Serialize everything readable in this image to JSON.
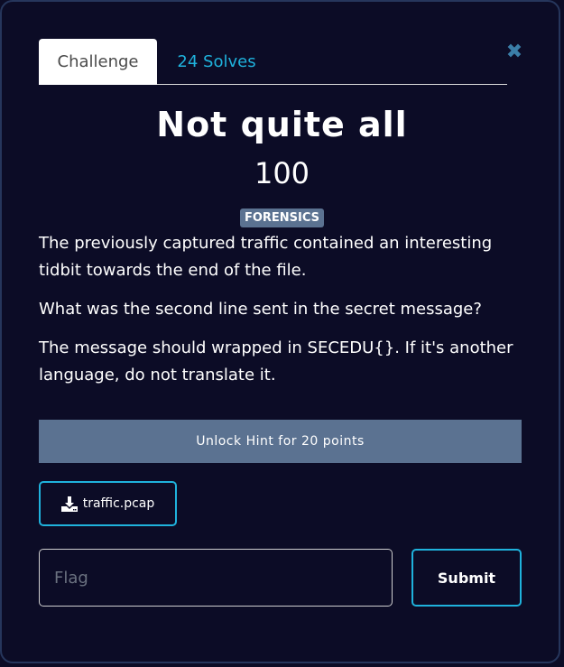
{
  "tabs": {
    "challenge_label": "Challenge",
    "solves_label": "24 Solves"
  },
  "close_icon": "close-icon",
  "challenge": {
    "title": "Not quite all",
    "points": "100",
    "category": "FORENSICS",
    "description": [
      "The previously captured traffic contained an interesting tidbit towards the end of the file.",
      "What was the second line sent in the secret message?",
      "The message should wrapped in SECEDU{}. If it's another language, do not translate it."
    ]
  },
  "hint": {
    "label": "Unlock Hint for 20 points"
  },
  "file": {
    "icon": "download-icon",
    "name": "traffic.pcap"
  },
  "flag": {
    "placeholder": "Flag",
    "value": ""
  },
  "submit": {
    "label": "Submit"
  },
  "colors": {
    "background": "#0c0c26",
    "accent": "#1fb2dc",
    "badge": "#5b7291",
    "close": "#3b7ea8"
  }
}
